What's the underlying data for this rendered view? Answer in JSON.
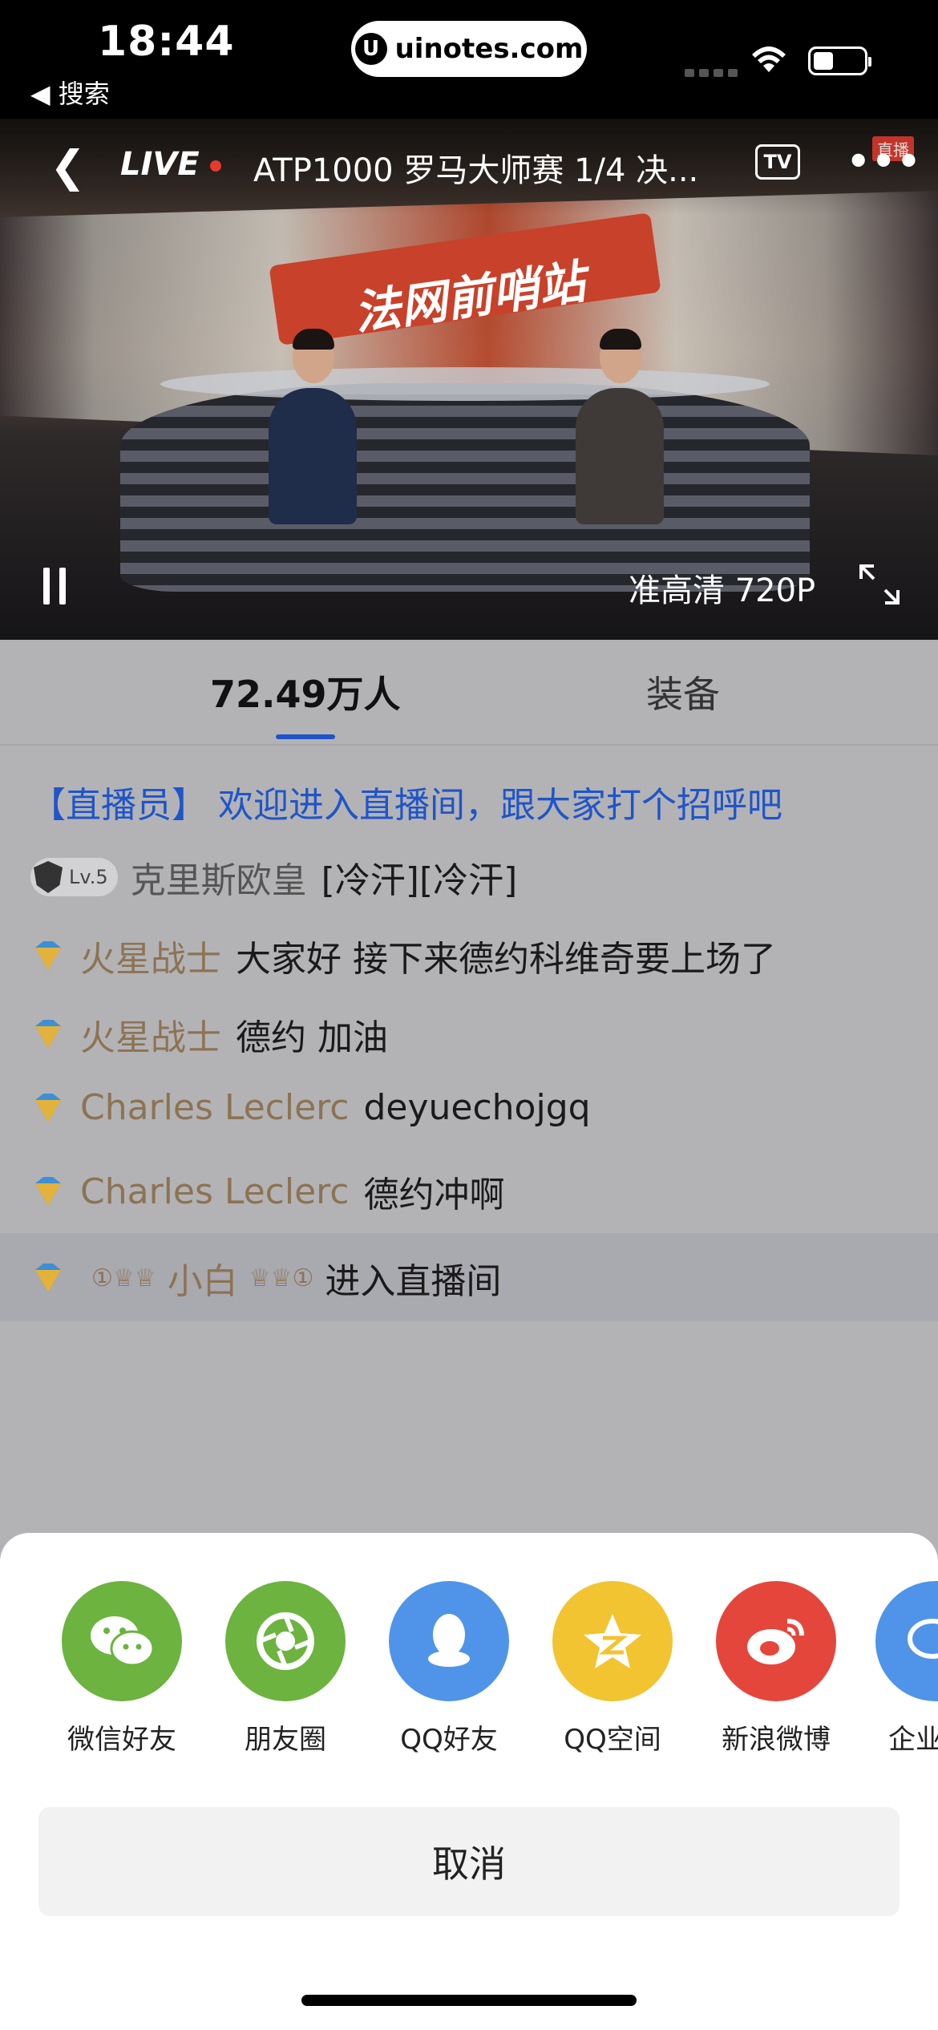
{
  "status_bar": {
    "time": "18:44",
    "back_app": "◀ 搜索",
    "url": "uinotes.com",
    "url_logo": "U"
  },
  "video": {
    "live_label": "LIVE",
    "title": "ATP1000 罗马大师赛 1/4 决...",
    "tv_label": "TV",
    "channel_badge": "直播",
    "studio_title": "法网前哨站",
    "quality": "准高清 720P",
    "icons": [
      "back-arrow-icon",
      "tv-cast-icon",
      "more-icon",
      "pause-icon",
      "fullscreen-icon"
    ]
  },
  "tabs": [
    {
      "label": "72.49万人",
      "active": true
    },
    {
      "label": "装备",
      "active": false
    }
  ],
  "chat": {
    "system": "【直播员】 欢迎进入直播间，跟大家打个招呼吧",
    "messages": [
      {
        "level": "Lv.5",
        "user": "克里斯欧皇",
        "text": "[冷汗][冷汗]"
      },
      {
        "user": "火星战士",
        "text": "大家好 接下来德约科维奇要上场了"
      },
      {
        "user": "火星战士",
        "text": "德约 加油"
      },
      {
        "user": "Charles Leclerc",
        "text": "deyuechojgq"
      },
      {
        "user": "Charles Leclerc",
        "text": "德约冲啊"
      }
    ],
    "entry": {
      "deco_left": "①♕♕",
      "user": "小白",
      "deco_right": "♕♕①",
      "text": "进入直播间"
    }
  },
  "share": {
    "items": [
      {
        "label": "微信好友",
        "icon": "wechat-icon",
        "color": "#6cb33f"
      },
      {
        "label": "朋友圈",
        "icon": "moments-icon",
        "color": "#6cb33f"
      },
      {
        "label": "QQ好友",
        "icon": "qq-icon",
        "color": "#4f94e8"
      },
      {
        "label": "QQ空间",
        "icon": "qzone-icon",
        "color": "#f2c431"
      },
      {
        "label": "新浪微博",
        "icon": "weibo-icon",
        "color": "#e5463c"
      },
      {
        "label": "企业",
        "icon": "enterprise-wechat-icon",
        "color": "#4f94e8"
      }
    ],
    "cancel": "取消"
  },
  "colors": {
    "accent_blue": "#1f55c8",
    "username_gold": "#8c7352",
    "live_red": "#e53a2e"
  }
}
